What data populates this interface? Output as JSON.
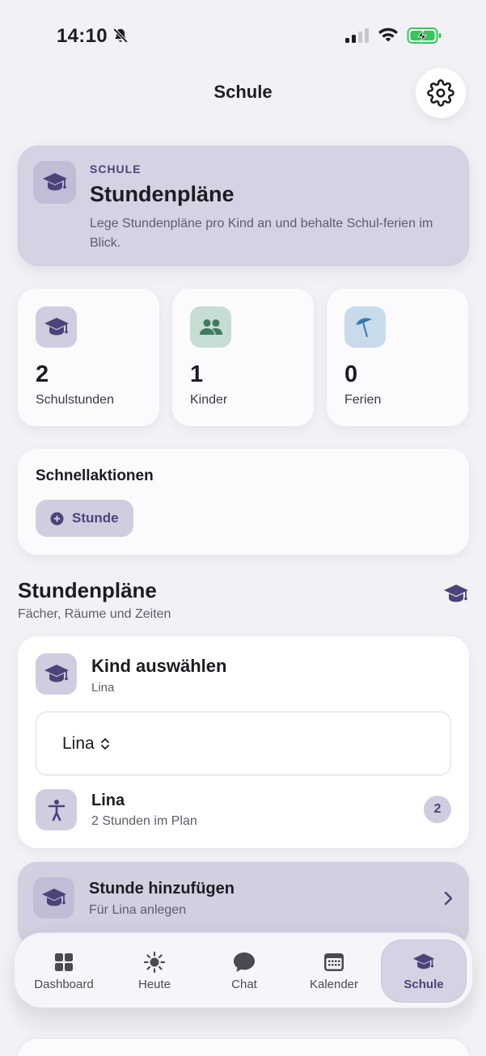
{
  "status_bar": {
    "time": "14:10"
  },
  "nav": {
    "title": "Schule"
  },
  "hero": {
    "eyebrow": "SCHULE",
    "title": "Stundenpläne",
    "description": "Lege Stundenpläne pro Kind an und behalte Schul-ferien im Blick."
  },
  "stats": [
    {
      "value": "2",
      "label": "Schulstunden",
      "icon": "graduation-cap-icon",
      "bg": "#d1cde0",
      "fg": "#4d4279"
    },
    {
      "value": "1",
      "label": "Kinder",
      "icon": "people-icon",
      "bg": "#c6ddd3",
      "fg": "#3f7a63"
    },
    {
      "value": "0",
      "label": "Ferien",
      "icon": "beach-umbrella-icon",
      "bg": "#c8dbea",
      "fg": "#3f7db3"
    }
  ],
  "quick_actions": {
    "title": "Schnellaktionen",
    "button_label": "Stunde"
  },
  "section": {
    "title": "Stundenpläne",
    "subtitle": "Fächer, Räume und Zeiten"
  },
  "kid_select": {
    "title": "Kind auswählen",
    "subtitle": "Lina",
    "picker_value": "Lina",
    "child": {
      "name": "Lina",
      "subtitle": "2 Stunden im Plan",
      "badge": "2"
    }
  },
  "add_lesson": {
    "title": "Stunde hinzufügen",
    "subtitle": "Für Lina anlegen"
  },
  "tabs": [
    {
      "label": "Dashboard",
      "icon": "grid-icon",
      "active": false
    },
    {
      "label": "Heute",
      "icon": "sun-icon",
      "active": false
    },
    {
      "label": "Chat",
      "icon": "chat-bubble-icon",
      "active": false
    },
    {
      "label": "Kalender",
      "icon": "calendar-icon",
      "active": false
    },
    {
      "label": "Schule",
      "icon": "graduation-cap-icon",
      "active": true
    }
  ],
  "colors": {
    "accent": "#4d4279",
    "background": "#f2f2f6",
    "battery_green": "#34c759"
  }
}
